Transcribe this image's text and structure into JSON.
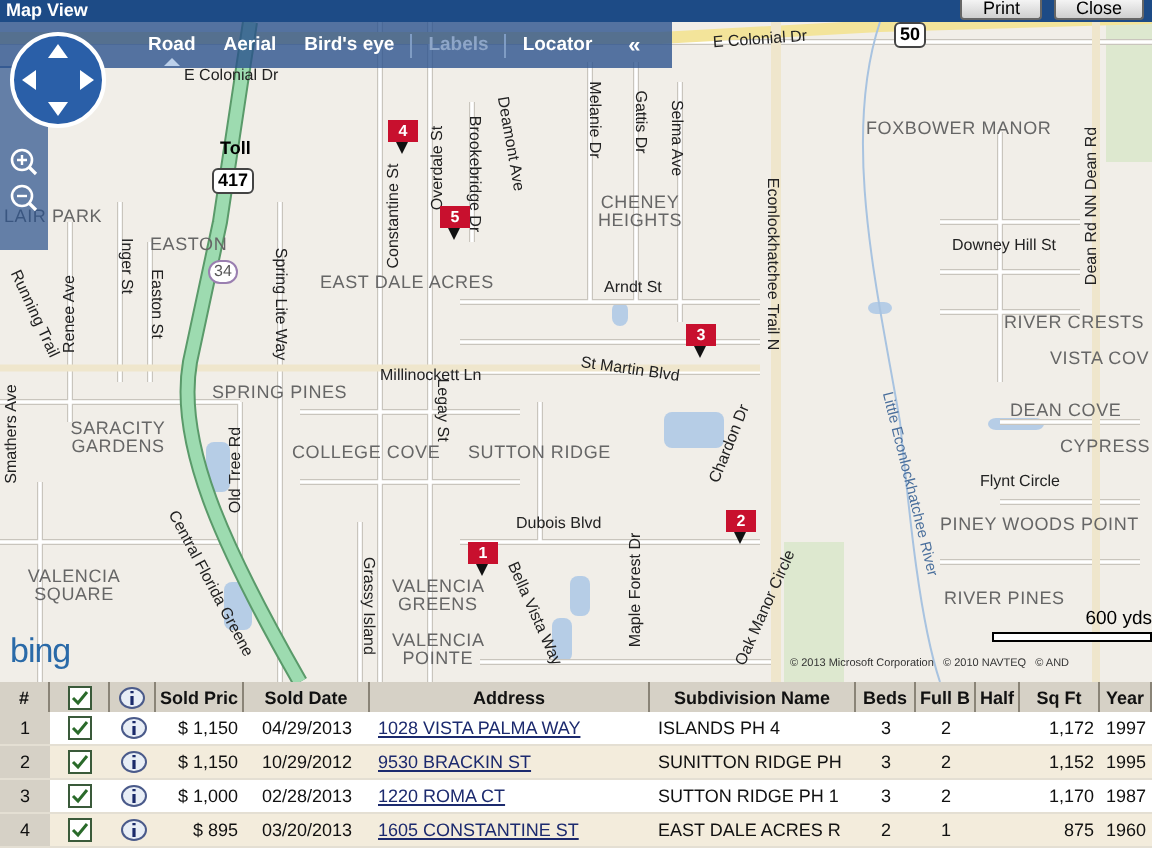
{
  "window": {
    "title": "Map View",
    "buttons": [
      "Print",
      "Close"
    ]
  },
  "map": {
    "tabs": [
      {
        "label": "Road",
        "selected": true,
        "disabled": false
      },
      {
        "label": "Aerial",
        "selected": false,
        "disabled": false
      },
      {
        "label": "Bird's eye",
        "selected": false,
        "disabled": false
      },
      {
        "label": "Labels",
        "selected": false,
        "disabled": true
      },
      {
        "label": "Locator",
        "selected": false,
        "disabled": false
      }
    ],
    "collapse_button": "«",
    "labels": [
      {
        "kind": "street",
        "text": "E Colonial Dr"
      },
      {
        "kind": "street",
        "text": "E Colonial Dr"
      },
      {
        "kind": "shield",
        "text": "50"
      },
      {
        "kind": "place",
        "text": "FOXBOWER MANOR"
      },
      {
        "kind": "street",
        "text": "Downey Hill St"
      },
      {
        "kind": "street",
        "text": "Dean Rd NN Dean Rd"
      },
      {
        "kind": "place",
        "text": "RIVER CRESTS"
      },
      {
        "kind": "place",
        "text": "VISTA COV"
      },
      {
        "kind": "place",
        "text": "DEAN COVE"
      },
      {
        "kind": "place",
        "text": "CYPRESS"
      },
      {
        "kind": "street",
        "text": "Flynt Circle"
      },
      {
        "kind": "place",
        "text": "PINEY WOODS POINT"
      },
      {
        "kind": "place",
        "text": "RIVER PINES"
      },
      {
        "kind": "river",
        "text": "Little Econlockhatchee River"
      },
      {
        "kind": "street",
        "text": "Econlockhatchee Trail N"
      },
      {
        "kind": "place",
        "text": "CHENEY HEIGHTS"
      },
      {
        "kind": "street",
        "text": "Arndt St"
      },
      {
        "kind": "street",
        "text": "Melanie Dr"
      },
      {
        "kind": "street",
        "text": "Gattis Dr"
      },
      {
        "kind": "street",
        "text": "Selma Ave"
      },
      {
        "kind": "street",
        "text": "Deamont Ave"
      },
      {
        "kind": "street",
        "text": "Brookebridge Dr"
      },
      {
        "kind": "street",
        "text": "Overdale St"
      },
      {
        "kind": "street",
        "text": "Constantine St"
      },
      {
        "kind": "toll",
        "text": "Toll"
      },
      {
        "kind": "shield",
        "text": "417"
      },
      {
        "kind": "place",
        "text": "LAIR PARK"
      },
      {
        "kind": "place",
        "text": "EASTON"
      },
      {
        "kind": "oval",
        "text": "34"
      },
      {
        "kind": "street",
        "text": "Inger St"
      },
      {
        "kind": "street",
        "text": "Easton St"
      },
      {
        "kind": "street",
        "text": "Renee Ave"
      },
      {
        "kind": "street",
        "text": "Running Trail"
      },
      {
        "kind": "street",
        "text": "Spring Lite Way"
      },
      {
        "kind": "place",
        "text": "EAST DALE ACRES"
      },
      {
        "kind": "street",
        "text": "Millinockett Ln"
      },
      {
        "kind": "street",
        "text": "St Martin Blvd"
      },
      {
        "kind": "place",
        "text": "SPRING PINES"
      },
      {
        "kind": "place",
        "text": "SARACITY GARDENS"
      },
      {
        "kind": "street",
        "text": "Smathers Ave"
      },
      {
        "kind": "street",
        "text": "Old Tree Rd"
      },
      {
        "kind": "place",
        "text": "COLLEGE COVE"
      },
      {
        "kind": "place",
        "text": "SUTTON RIDGE"
      },
      {
        "kind": "street",
        "text": "Legay St"
      },
      {
        "kind": "street",
        "text": "Chardon Dr"
      },
      {
        "kind": "street",
        "text": "Dubois Blvd"
      },
      {
        "kind": "place",
        "text": "VALENCIA SQUARE"
      },
      {
        "kind": "street",
        "text": "Central Florida Greene"
      },
      {
        "kind": "street",
        "text": "Grassy Island"
      },
      {
        "kind": "place",
        "text": "VALENCIA GREENS"
      },
      {
        "kind": "street",
        "text": "Bella Vista Way"
      },
      {
        "kind": "place",
        "text": "VALENCIA POINTE"
      },
      {
        "kind": "street",
        "text": "Maple Forest Dr"
      },
      {
        "kind": "street",
        "text": "Oak Manor Circle"
      }
    ],
    "pins": [
      {
        "number": "1"
      },
      {
        "number": "2"
      },
      {
        "number": "3"
      },
      {
        "number": "4"
      },
      {
        "number": "5"
      }
    ],
    "logo": "bing",
    "scale": "600 yds",
    "copyright": "© 2013 Microsoft Corporation   © 2010 NAVTEQ   © AND"
  },
  "table": {
    "columns": [
      "#",
      "",
      "",
      "Sold Pric",
      "Sold Date",
      "Address",
      "Subdivision Name",
      "Beds",
      "Full B",
      "Half",
      "Sq Ft",
      "Year"
    ],
    "all_checked": true,
    "rows": [
      {
        "number": "1",
        "checked": true,
        "price": "$ 1,150",
        "date": "04/29/2013",
        "address": "1028 VISTA PALMA WAY",
        "subdivision": "ISLANDS PH 4",
        "beds": "3",
        "full": "2",
        "sqft": "1,172",
        "year": "1997"
      },
      {
        "number": "2",
        "checked": true,
        "price": "$ 1,150",
        "date": "10/29/2012",
        "address": "9530 BRACKIN ST",
        "subdivision": "SUNITTON RIDGE PH",
        "beds": "3",
        "full": "2",
        "sqft": "1,152",
        "year": "1995"
      },
      {
        "number": "3",
        "checked": true,
        "price": "$ 1,000",
        "date": "02/28/2013",
        "address": "1220 ROMA CT",
        "subdivision": "SUTTON RIDGE PH 1",
        "beds": "3",
        "full": "2",
        "sqft": "1,170",
        "year": "1987"
      },
      {
        "number": "4",
        "checked": true,
        "price": "$ 895",
        "date": "03/20/2013",
        "address": "1605 CONSTANTINE ST",
        "subdivision": "EAST DALE ACRES R",
        "beds": "2",
        "full": "1",
        "sqft": "875",
        "year": "1960"
      }
    ]
  }
}
